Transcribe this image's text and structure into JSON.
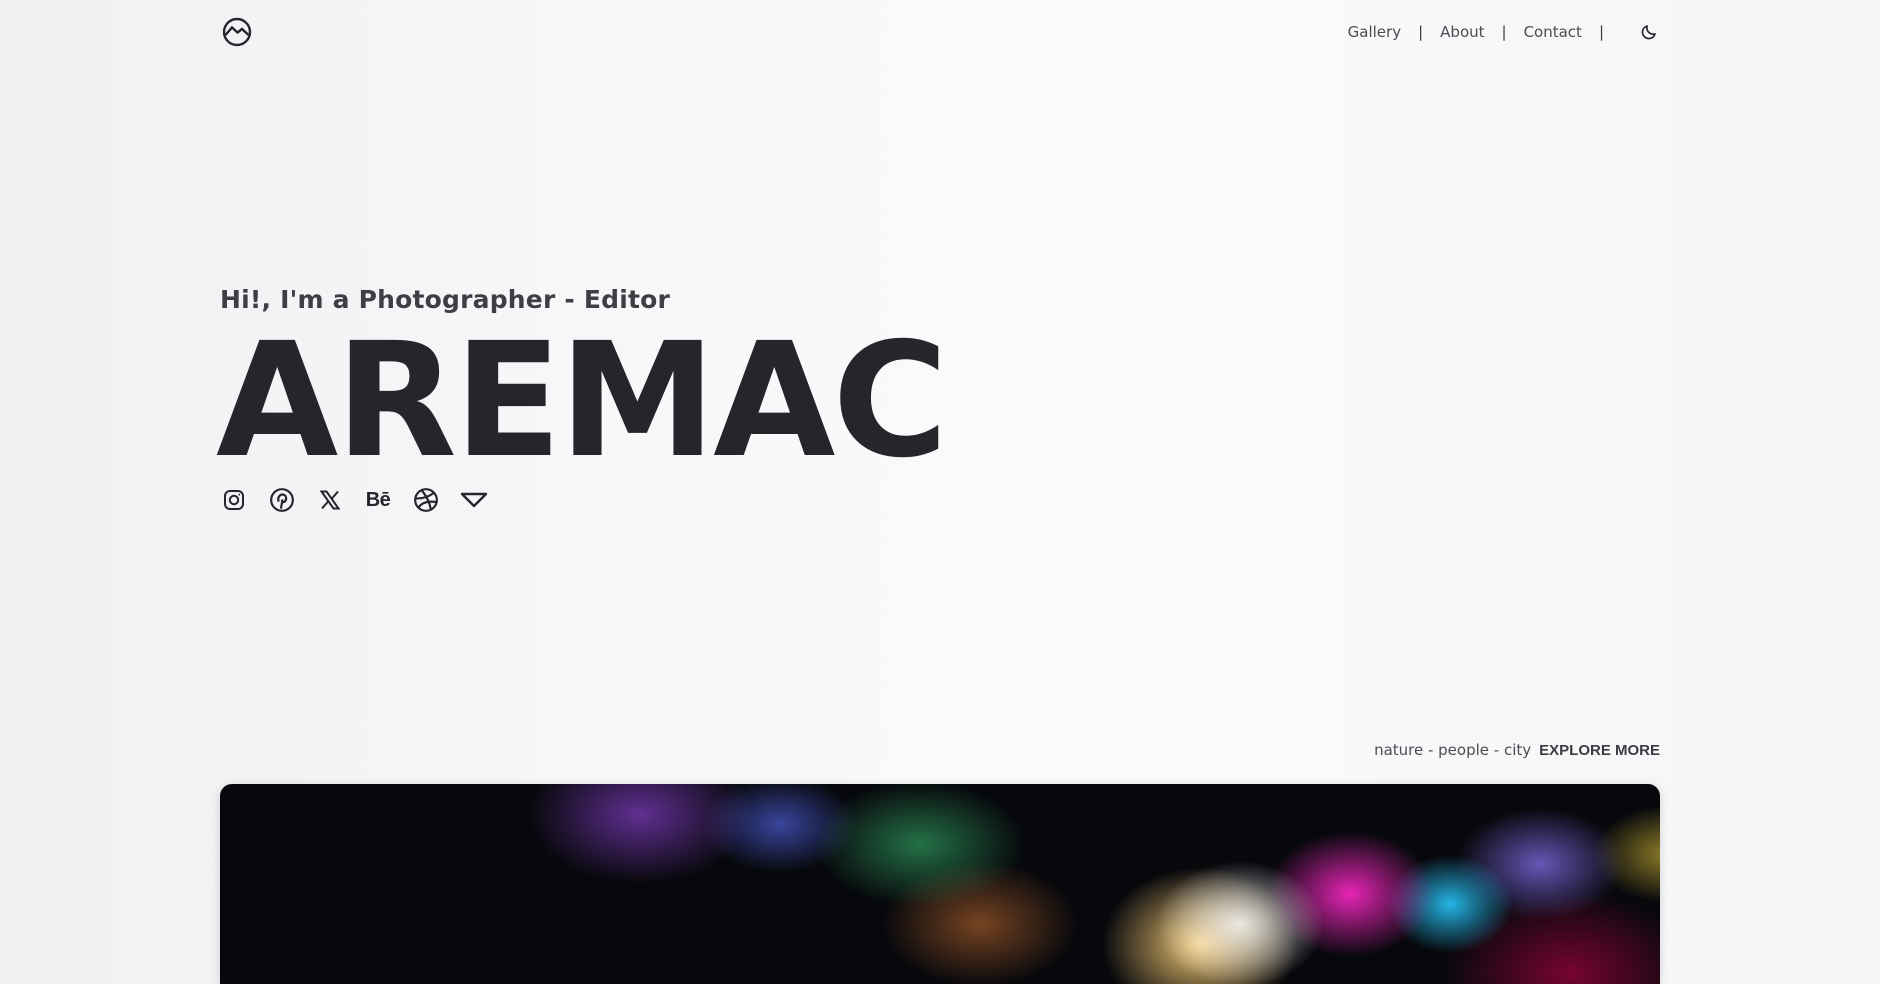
{
  "brand": {
    "logo_icon": "mountain-circle-icon"
  },
  "nav": {
    "items": [
      {
        "label": "Gallery"
      },
      {
        "label": "About"
      },
      {
        "label": "Contact"
      }
    ],
    "separator": "|",
    "theme_icon": "moon-icon"
  },
  "hero": {
    "subtitle": "Hi!, I'm a Photographer - Editor",
    "title": "AREMAC"
  },
  "socials": [
    {
      "name": "instagram-icon"
    },
    {
      "name": "pinterest-icon"
    },
    {
      "name": "x-icon"
    },
    {
      "name": "behance-icon",
      "glyph": "Bē"
    },
    {
      "name": "dribbble-icon"
    },
    {
      "name": "down-triangle-icon"
    }
  ],
  "explore": {
    "tags": "nature - people - city",
    "link": "EXPLORE MORE"
  },
  "colors": {
    "text": "#24262b",
    "muted": "#4a4c52"
  }
}
